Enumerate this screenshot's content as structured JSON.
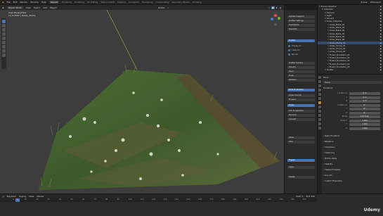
{
  "topbar": {
    "app": "Blender",
    "menus": [
      "File",
      "Edit",
      "Render",
      "Window",
      "Help"
    ],
    "workspaces": [
      "Layout",
      "Modeling",
      "Sculpting",
      "UV Editing",
      "Texture Paint",
      "Shading",
      "Animation",
      "Rendering",
      "Compositing",
      "Geometry Nodes",
      "Scripting"
    ],
    "scene": "Scene",
    "view_layer": "ViewLayer"
  },
  "viewport": {
    "header": {
      "mode": "Object Mode",
      "menus": [
        "View",
        "Select",
        "Add",
        "Object"
      ],
      "transform": "Global"
    },
    "info_line1": "User Perspective",
    "info_line2": "(1) Scatter | Grass_Clump"
  },
  "npanel": {
    "top_buttons": [
      "Update Viewport",
      "Scatter Settings",
      "Distribution",
      "Populate"
    ],
    "toggles": [
      "Display As",
      "Viewport",
      "Render"
    ],
    "section_a": "Scatter",
    "options": [
      "Scatter Surface",
      "Density",
      "Seed",
      "Scale",
      "Rotation"
    ],
    "values": [
      "1.00",
      "1.000",
      "0",
      "1.000",
      "0°"
    ],
    "buttons": [
      "Point to Surface",
      "Grass Clumps",
      "Flowers",
      "Add to Selection",
      "Remove",
      "Convert"
    ],
    "highlight": "Grass",
    "bottom_buttons": [
      "Show",
      "Hide",
      "Toggle",
      "Apply",
      "Delete"
    ]
  },
  "outliner": {
    "rows": [
      {
        "name": "Scene Collection",
        "indent": 0
      },
      {
        "name": "Collection",
        "indent": 1
      },
      {
        "name": "Camera",
        "indent": 2
      },
      {
        "name": "Light",
        "indent": 2
      },
      {
        "name": "Ground",
        "indent": 2
      },
      {
        "name": "Grass_Collection",
        "indent": 2
      },
      {
        "name": "Grass_Blade_01",
        "indent": 3
      },
      {
        "name": "Grass_Blade_02",
        "indent": 3
      },
      {
        "name": "Grass_Blade_03",
        "indent": 3
      },
      {
        "name": "Grass_Blade_04",
        "indent": 3
      },
      {
        "name": "Grass_Blade_05",
        "indent": 3
      },
      {
        "name": "Grass_Blade_06",
        "indent": 3
      },
      {
        "name": "Grass_Clump_01",
        "indent": 3
      },
      {
        "name": "Grass_Clump_02",
        "indent": 3
      },
      {
        "name": "Grass_Clump_03",
        "indent": 3
      },
      {
        "name": "Grass_Clump_04",
        "indent": 3
      },
      {
        "name": "Flower_Dandelion_01",
        "indent": 3
      },
      {
        "name": "Flower_Dandelion_02",
        "indent": 3
      },
      {
        "name": "Flower_Dandelion_03",
        "indent": 3
      },
      {
        "name": "Flower_Dandelion_04",
        "indent": 3
      },
      {
        "name": "Flower_Dandelion_05",
        "indent": 3
      },
      {
        "name": "Scatter",
        "indent": 2
      }
    ]
  },
  "properties": {
    "header": "Plane",
    "sub": "Plane",
    "transform_title": "Transform",
    "rows": [
      {
        "label": "Location X",
        "value": "0 m"
      },
      {
        "label": "Y",
        "value": "0 m"
      },
      {
        "label": "Z",
        "value": "0 m"
      },
      {
        "label": "Rotation X",
        "value": "0°"
      },
      {
        "label": "Y",
        "value": "0°"
      },
      {
        "label": "Z",
        "value": "0°"
      },
      {
        "label": "Mode",
        "value": "XYZ Euler"
      },
      {
        "label": "Scale X",
        "value": "1.000"
      },
      {
        "label": "Y",
        "value": "1.000"
      },
      {
        "label": "Z",
        "value": "1.000"
      }
    ],
    "sections": [
      "Delta Transform",
      "Relations",
      "Collections",
      "Instancing",
      "Motion Paths",
      "Visibility",
      "Viewport Display",
      "Line Art",
      "Custom Properties"
    ]
  },
  "timeline": {
    "menus": [
      "Playback",
      "Keying",
      "View",
      "Marker"
    ],
    "ticks": [
      "0",
      "10",
      "20",
      "30",
      "40",
      "50",
      "60",
      "70",
      "80",
      "90",
      "100",
      "110",
      "120",
      "130",
      "140",
      "150",
      "160",
      "170",
      "180",
      "190",
      "200",
      "210",
      "220",
      "230",
      "240",
      "250"
    ],
    "current_frame": "1",
    "start": "Start 1",
    "end": "End 250"
  },
  "watermark": "Udemy"
}
